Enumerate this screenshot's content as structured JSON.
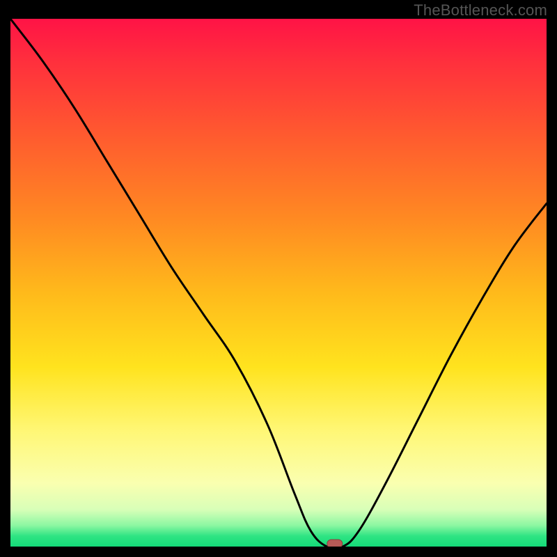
{
  "watermark": "TheBottleneck.com",
  "chart_data": {
    "type": "line",
    "title": "",
    "xlabel": "",
    "ylabel": "",
    "xlim": [
      0,
      100
    ],
    "ylim": [
      0,
      100
    ],
    "grid": false,
    "legend": false,
    "series": [
      {
        "name": "bottleneck-curve",
        "x": [
          0,
          6,
          12,
          18,
          24,
          30,
          36,
          42,
          48,
          53,
          56,
          59,
          62,
          65,
          70,
          76,
          82,
          88,
          94,
          100
        ],
        "y": [
          100,
          92,
          83,
          73,
          63,
          53,
          44,
          35,
          23,
          10,
          3,
          0,
          0,
          3,
          12,
          24,
          36,
          47,
          57,
          65
        ]
      }
    ],
    "marker": {
      "x": 60.5,
      "y": 0,
      "shape": "pill",
      "color": "#b75a57"
    },
    "background_gradient": {
      "type": "vertical",
      "stops": [
        {
          "pos": 0,
          "color": "#ff1346"
        },
        {
          "pos": 22,
          "color": "#ff5a2f"
        },
        {
          "pos": 52,
          "color": "#ffba1b"
        },
        {
          "pos": 78,
          "color": "#fff775"
        },
        {
          "pos": 93,
          "color": "#d8ffb8"
        },
        {
          "pos": 100,
          "color": "#14da79"
        }
      ]
    }
  }
}
